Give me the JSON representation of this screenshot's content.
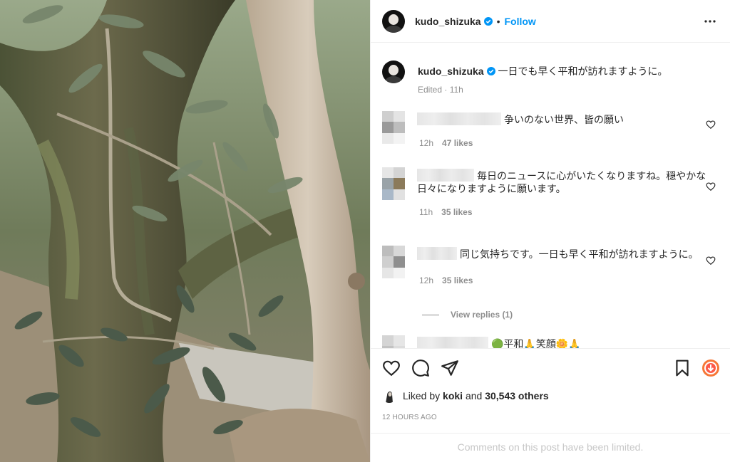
{
  "header": {
    "username": "kudo_shizuka",
    "separator": "•",
    "follow_label": "Follow"
  },
  "caption": {
    "username": "kudo_shizuka",
    "text": "一日でも早く平和が訪れますように。",
    "meta": "Edited · 11h"
  },
  "comments": [
    {
      "text": "争いのない世界、皆の願い",
      "time": "12h",
      "likes": "47 likes"
    },
    {
      "text": "毎日のニュースに心がいたくなりますね。穏やかな日々になりますように願います。",
      "time": "11h",
      "likes": "35 likes"
    },
    {
      "text": "同じ気持ちです。一日も早く平和が訪れますように。",
      "time": "12h",
      "likes": "35 likes"
    }
  ],
  "view_replies": "View replies (1)",
  "partial_comment": "🟢平和🙏笑顔🌼🙏",
  "likes_line": {
    "prefix": "Liked by ",
    "user": "koki",
    "middle": " and ",
    "count": "30,543 others"
  },
  "time_ago": "12 HOURS AGO",
  "comments_limited": "Comments on this post have been limited.",
  "colors": {
    "accent": "#0095f6",
    "text": "#262626",
    "secondary": "#8e8e8e",
    "border": "#efefef",
    "disabled": "#c7c7c7"
  },
  "icons": [
    "verified-badge-icon",
    "more-options-icon",
    "heart-icon",
    "comment-icon",
    "share-icon",
    "bookmark-icon",
    "activity-icon"
  ]
}
